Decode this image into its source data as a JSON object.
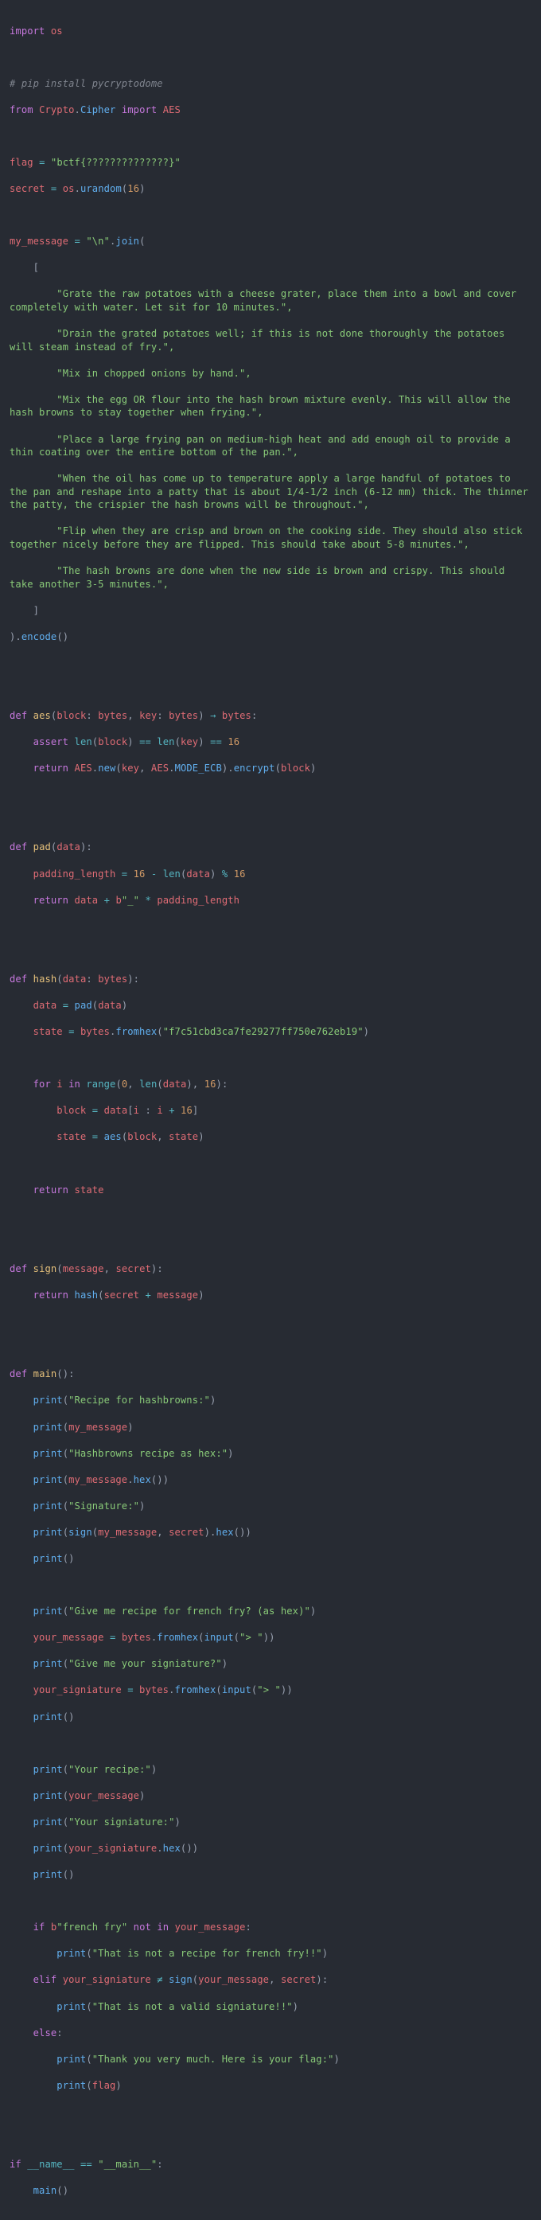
{
  "editor": {
    "background": "#272b33",
    "foreground": "#b6bcc9",
    "language": "python",
    "palette": {
      "keyword": "#c678dd",
      "string": "#89ca78",
      "number": "#d19a66",
      "function": "#61afef",
      "function_def": "#e5c07b",
      "variable": "#e06c75",
      "operator": "#56b6c2",
      "punctuation": "#9aa2b1",
      "comment": "#7f848e"
    }
  },
  "code": {
    "import_os": {
      "kw": "import",
      "module": "os"
    },
    "comment_pip": "# pip install pycryptodome",
    "import_aes": {
      "from": "from",
      "pkg": "Crypto",
      "dot": ".",
      "sub": "Cipher",
      "import": "import",
      "name": "AES"
    },
    "flag": {
      "name": "flag",
      "eq": "=",
      "value": "\"bctf{??????????????}\""
    },
    "secret": {
      "name": "secret",
      "eq": "=",
      "mod": "os",
      "dot": ".",
      "call": "urandom",
      "open": "(",
      "arg": "16",
      "close": ")"
    },
    "my_message_head": {
      "name": "my_message",
      "eq": "=",
      "sep": "\"\\n\"",
      "dot": ".",
      "call": "join",
      "open": "("
    },
    "bracket_open": "[",
    "bracket_close": "]",
    "encode_tail": {
      "close": ")",
      "dot": ".",
      "call": "encode",
      "parens": "()"
    },
    "recipe_steps": [
      "\"Grate the raw potatoes with a cheese grater, place them into a bowl and cover completely with water. Let sit for 10 minutes.\",",
      "\"Drain the grated potatoes well; if this is not done thoroughly the potatoes will steam instead of fry.\",",
      "\"Mix in chopped onions by hand.\",",
      "\"Mix the egg OR flour into the hash brown mixture evenly. This will allow the hash browns to stay together when frying.\",",
      "\"Place a large frying pan on medium-high heat and add enough oil to provide a thin coating over the entire bottom of the pan.\",",
      "\"When the oil has come up to temperature apply a large handful of potatoes to the pan and reshape into a patty that is about 1/4-1/2 inch (6-12 mm) thick. The thinner the patty, the crispier the hash browns will be throughout.\",",
      "\"Flip when they are crisp and brown on the cooking side. They should also stick together nicely before they are flipped. This should take about 5-8 minutes.\",",
      "\"The hash browns are done when the new side is brown and crispy. This should take another 3-5 minutes.\","
    ],
    "def_aes": {
      "kw": "def",
      "name": "aes",
      "open": "(",
      "p1": "block",
      "c1": ":",
      "t1": "bytes",
      "comma": ",",
      "p2": "key",
      "c2": ":",
      "t2": "bytes",
      "close": ")",
      "arrow": "→",
      "ret": "bytes",
      "colon": ":"
    },
    "aes_assert": {
      "kw": "assert",
      "len1": "len",
      "o1": "(",
      "a1": "block",
      "c1": ")",
      "eq1": "==",
      "len2": "len",
      "o2": "(",
      "a2": "key",
      "c2": ")",
      "eq2": "==",
      "num": "16"
    },
    "aes_return": {
      "kw": "return",
      "cls": "AES",
      "d1": ".",
      "new": "new",
      "o1": "(",
      "key": "key",
      "comma": ",",
      "cls2": "AES",
      "d2": ".",
      "mode": "MODE_ECB",
      "c1": ")",
      "d3": ".",
      "enc": "encrypt",
      "o2": "(",
      "blk": "block",
      "c2": ")"
    },
    "def_pad": {
      "kw": "def",
      "name": "pad",
      "open": "(",
      "arg": "data",
      "close": ")",
      "colon": ":"
    },
    "pad_len": {
      "name": "padding_length",
      "eq": "=",
      "n1": "16",
      "minus": "-",
      "len": "len",
      "o": "(",
      "arg": "data",
      "c": ")",
      "mod": "%",
      "n2": "16"
    },
    "pad_return": {
      "kw": "return",
      "data": "data",
      "plus": "+",
      "b": "b",
      "lit": "\"_\"",
      "star": "*",
      "name": "padding_length"
    },
    "def_hash": {
      "kw": "def",
      "name": "hash",
      "open": "(",
      "arg": "data",
      "colon": ":",
      "type": "bytes",
      "close": ")",
      "end": ":"
    },
    "hash_pad": {
      "lhs": "data",
      "eq": "=",
      "call": "pad",
      "o": "(",
      "arg": "data",
      "c": ")"
    },
    "hash_state": {
      "lhs": "state",
      "eq": "=",
      "mod": "bytes",
      "dot": ".",
      "call": "fromhex",
      "o": "(",
      "hex": "\"f7c51cbd3ca7fe29277ff750e762eb19\"",
      "c": ")"
    },
    "hash_for": {
      "kw_for": "for",
      "i": "i",
      "kw_in": "in",
      "range": "range",
      "o": "(",
      "start": "0",
      "comma1": ",",
      "len": "len",
      "o2": "(",
      "arg": "data",
      "c2": ")",
      "comma2": ",",
      "step": "16",
      "c": ")",
      "colon": ":"
    },
    "hash_block": {
      "lhs": "block",
      "eq": "=",
      "data": "data",
      "ob": "[",
      "i": "i",
      "colon": ":",
      "i2": "i",
      "plus": "+",
      "n": "16",
      "cb": "]"
    },
    "hash_state2": {
      "lhs": "state",
      "eq": "=",
      "call": "aes",
      "o": "(",
      "a1": "block",
      "comma": ",",
      "a2": "state",
      "c": ")"
    },
    "hash_return": {
      "kw": "return",
      "val": "state"
    },
    "def_sign": {
      "kw": "def",
      "name": "sign",
      "open": "(",
      "p1": "message",
      "comma": ",",
      "p2": "secret",
      "close": ")",
      "colon": ":"
    },
    "sign_return": {
      "kw": "return",
      "call": "hash",
      "o": "(",
      "a1": "secret",
      "plus": "+",
      "a2": "message",
      "c": ")"
    },
    "def_main": {
      "kw": "def",
      "name": "main",
      "parens": "()",
      "colon": ":"
    },
    "main_prints": [
      {
        "fn": "print",
        "arg": "\"Recipe for hashbrowns:\"",
        "type": "str"
      },
      {
        "fn": "print",
        "arg": "my_message",
        "type": "var"
      },
      {
        "fn": "print",
        "arg": "\"Hashbrowns recipe as hex:\"",
        "type": "str"
      },
      {
        "fn": "print",
        "arg": "my_message.hex()",
        "type": "method"
      },
      {
        "fn": "print",
        "arg": "\"Signature:\"",
        "type": "str"
      },
      {
        "fn": "print",
        "arg": "sign(my_message, secret).hex()",
        "type": "call"
      },
      {
        "fn": "print",
        "arg": "",
        "type": "empty"
      }
    ],
    "ask_recipe": {
      "fn": "print",
      "arg": "\"Give me recipe for french fry? (as hex)\""
    },
    "your_message": {
      "lhs": "your_message",
      "eq": "=",
      "mod": "bytes",
      "dot": ".",
      "call": "fromhex",
      "o": "(",
      "input": "input",
      "o2": "(",
      "prompt": "\"> \"",
      "c2": ")",
      "c": ")"
    },
    "ask_sig": {
      "fn": "print",
      "arg": "\"Give me your signiature?\""
    },
    "your_signiature": {
      "lhs": "your_signiature",
      "eq": "=",
      "mod": "bytes",
      "dot": ".",
      "call": "fromhex",
      "o": "(",
      "input": "input",
      "o2": "(",
      "prompt": "\"> \"",
      "c2": ")",
      "c": ")"
    },
    "echo_prints": [
      {
        "fn": "print",
        "arg": "\"Your recipe:\"",
        "type": "str"
      },
      {
        "fn": "print",
        "arg": "your_message",
        "type": "var"
      },
      {
        "fn": "print",
        "arg": "\"Your signiature:\"",
        "type": "str"
      },
      {
        "fn": "print",
        "arg": "your_signiature.hex()",
        "type": "method"
      },
      {
        "fn": "print",
        "arg": "",
        "type": "empty"
      }
    ],
    "if_fry": {
      "kw_if": "if",
      "b": "b",
      "lit": "\"french fry\"",
      "kw_not": "not",
      "kw_in": "in",
      "var": "your_message",
      "colon": ":"
    },
    "print_not_recipe": {
      "fn": "print",
      "arg": "\"That is not a recipe for french fry!!\""
    },
    "elif_sig": {
      "kw": "elif",
      "lhs": "your_signiature",
      "ne": "≠",
      "call": "sign",
      "o": "(",
      "a1": "your_message",
      "comma": ",",
      "a2": "secret",
      "c": ")",
      "colon": ":"
    },
    "print_bad_sig": {
      "fn": "print",
      "arg": "\"That is not a valid signiature!!\""
    },
    "else_kw": {
      "kw": "else",
      "colon": ":"
    },
    "print_thanks": {
      "fn": "print",
      "arg": "\"Thank you very much. Here is your flag:\""
    },
    "print_flag": {
      "fn": "print",
      "arg": "flag"
    },
    "main_guard": {
      "kw": "if",
      "name": "__name__",
      "eq": "==",
      "value": "\"__main__\"",
      "colon": ":"
    },
    "main_call": {
      "name": "main",
      "parens": "()"
    }
  }
}
